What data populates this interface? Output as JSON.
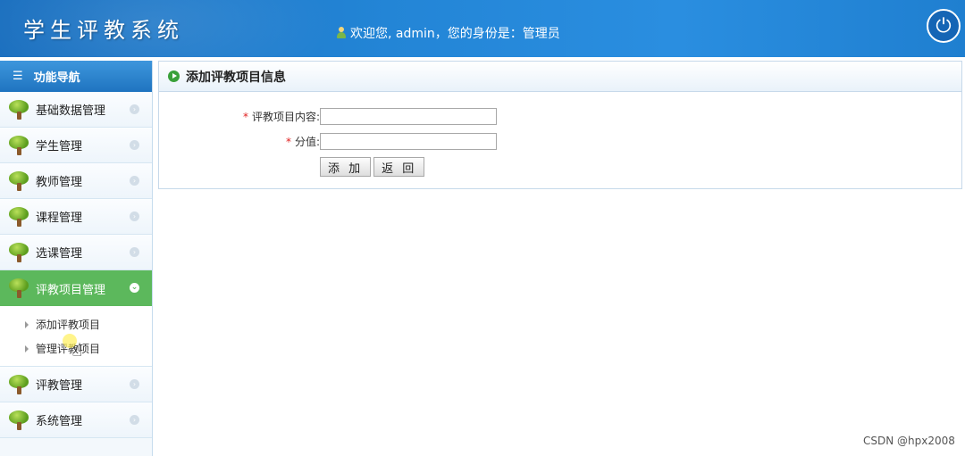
{
  "header": {
    "title": "学生评教系统",
    "welcome": "欢迎您, admin，您的身份是：管理员",
    "power_icon": "power-icon"
  },
  "sidebar": {
    "heading": "功能导航",
    "items": [
      {
        "label": "基础数据管理"
      },
      {
        "label": "学生管理"
      },
      {
        "label": "教师管理"
      },
      {
        "label": "课程管理"
      },
      {
        "label": "选课管理"
      },
      {
        "label": "评教项目管理"
      },
      {
        "label": "评教管理"
      },
      {
        "label": "系统管理"
      }
    ],
    "active_index": 5,
    "submenu": [
      {
        "label": "添加评教项目"
      },
      {
        "label": "管理评教项目"
      }
    ]
  },
  "panel": {
    "title": "添加评教项目信息",
    "fields": [
      {
        "required_mark": "*",
        "label": "评教项目内容:",
        "value": "",
        "placeholder": ""
      },
      {
        "required_mark": "*",
        "label": "分值:",
        "value": "",
        "placeholder": ""
      }
    ],
    "buttons": {
      "add": "添 加",
      "back": "返 回"
    }
  },
  "watermark": "CSDN @hpx2008",
  "colors": {
    "header": "#2385d6",
    "active_nav": "#5cb85c",
    "required": "#e02020"
  }
}
